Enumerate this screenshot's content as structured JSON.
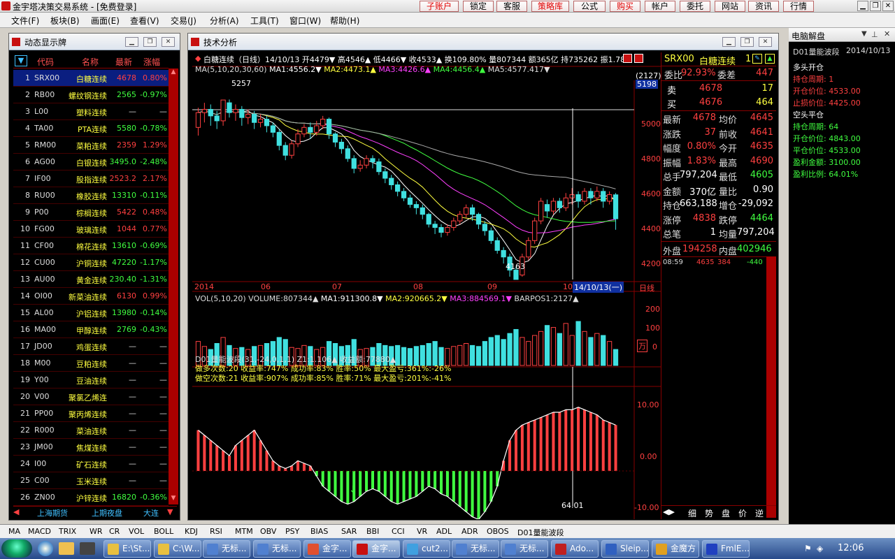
{
  "app": {
    "title": "金宇塔决策交易系统 - [免费登录]"
  },
  "topbuttons": [
    {
      "label": "子账户",
      "red": true
    },
    {
      "label": "锁定",
      "red": false
    },
    {
      "label": "客服",
      "red": false
    },
    {
      "label": "策略库",
      "red": true
    },
    {
      "label": "公式",
      "red": false
    },
    {
      "label": "购买",
      "red": true
    },
    {
      "label": "帐户",
      "red": false
    },
    {
      "label": "委托",
      "red": false
    },
    {
      "label": "网站",
      "red": false
    },
    {
      "label": "资讯",
      "red": false
    },
    {
      "label": "行情",
      "red": false
    }
  ],
  "menu": [
    "文件(F)",
    "板块(B)",
    "画面(E)",
    "查看(V)",
    "交易(J)",
    "分析(A)",
    "工具(T)",
    "窗口(W)",
    "帮助(H)"
  ],
  "leftpanel": {
    "title": "动态显示牌",
    "headers": {
      "code": "代码",
      "name": "名称",
      "last": "最新",
      "chg": "涨幅"
    },
    "rows": [
      {
        "n": "1",
        "code": "SRX00",
        "name": "白糖连续",
        "last": "4678",
        "chg": "0.80%",
        "up": true
      },
      {
        "n": "2",
        "code": "RB00",
        "name": "螺纹钢连续",
        "last": "2565",
        "chg": "-0.97%",
        "up": false
      },
      {
        "n": "3",
        "code": "L00",
        "name": "塑料连续",
        "last": "—",
        "chg": "—",
        "up": null
      },
      {
        "n": "4",
        "code": "TA00",
        "name": "PTA连续",
        "last": "5580",
        "chg": "-0.78%",
        "up": false
      },
      {
        "n": "5",
        "code": "RM00",
        "name": "菜粕连续",
        "last": "2359",
        "chg": "1.29%",
        "up": true
      },
      {
        "n": "6",
        "code": "AG00",
        "name": "白银连续",
        "last": "3495.0",
        "chg": "-2.48%",
        "up": false
      },
      {
        "n": "7",
        "code": "IF00",
        "name": "股指连续",
        "last": "2523.2",
        "chg": "2.17%",
        "up": true
      },
      {
        "n": "8",
        "code": "RU00",
        "name": "橡胶连续",
        "last": "13310",
        "chg": "-0.11%",
        "up": false
      },
      {
        "n": "9",
        "code": "P00",
        "name": "棕榈连续",
        "last": "5422",
        "chg": "0.48%",
        "up": true
      },
      {
        "n": "10",
        "code": "FG00",
        "name": "玻璃连续",
        "last": "1044",
        "chg": "0.77%",
        "up": true
      },
      {
        "n": "11",
        "code": "CF00",
        "name": "棉花连续",
        "last": "13610",
        "chg": "-0.69%",
        "up": false
      },
      {
        "n": "12",
        "code": "CU00",
        "name": "沪铜连续",
        "last": "47220",
        "chg": "-1.17%",
        "up": false
      },
      {
        "n": "13",
        "code": "AU00",
        "name": "黄金连续",
        "last": "230.40",
        "chg": "-1.31%",
        "up": false
      },
      {
        "n": "14",
        "code": "OI00",
        "name": "新菜油连续",
        "last": "6130",
        "chg": "0.99%",
        "up": true
      },
      {
        "n": "15",
        "code": "AL00",
        "name": "沪铝连续",
        "last": "13980",
        "chg": "-0.14%",
        "up": false
      },
      {
        "n": "16",
        "code": "MA00",
        "name": "甲醇连续",
        "last": "2769",
        "chg": "-0.43%",
        "up": false
      },
      {
        "n": "17",
        "code": "JD00",
        "name": "鸡蛋连续",
        "last": "—",
        "chg": "—",
        "up": null
      },
      {
        "n": "18",
        "code": "M00",
        "name": "豆粕连续",
        "last": "—",
        "chg": "—",
        "up": null
      },
      {
        "n": "19",
        "code": "Y00",
        "name": "豆油连续",
        "last": "—",
        "chg": "—",
        "up": null
      },
      {
        "n": "20",
        "code": "V00",
        "name": "聚氯乙烯连",
        "last": "—",
        "chg": "—",
        "up": null
      },
      {
        "n": "21",
        "code": "PP00",
        "name": "聚丙烯连续",
        "last": "—",
        "chg": "—",
        "up": null
      },
      {
        "n": "22",
        "code": "R000",
        "name": "菜油连续",
        "last": "—",
        "chg": "—",
        "up": null
      },
      {
        "n": "23",
        "code": "JM00",
        "name": "焦煤连续",
        "last": "—",
        "chg": "—",
        "up": null
      },
      {
        "n": "24",
        "code": "I00",
        "name": "矿石连续",
        "last": "—",
        "chg": "—",
        "up": null
      },
      {
        "n": "25",
        "code": "C00",
        "name": "玉米连续",
        "last": "—",
        "chg": "—",
        "up": null
      },
      {
        "n": "26",
        "code": "ZN00",
        "name": "沪锌连续",
        "last": "16820",
        "chg": "-0.36%",
        "up": false
      }
    ],
    "tabs": [
      "上海期货",
      "上期夜盘",
      "大连"
    ]
  },
  "ta": {
    "title": "技术分析",
    "header": "白糖连续（日线）14/10/13 开4479▼ 高4546▲ 低4466▼ 收4533▲ 换109.80% 量807344 额365亿 持735262 振1.78%",
    "ma_line": {
      "prefix": "MA(5,10,20,30,60)",
      "ma1": "MA1:4556.2▼",
      "ma2": "MA2:4473.1▲",
      "ma3": "MA3:4426.6▲",
      "ma4": "MA4:4456.4▲",
      "ma5": "MA5:4577.417▼"
    },
    "vol_line": {
      "prefix": "VOL(5,10,20) VOLUME:807344▲",
      "ma1": "MA1:911300.8▼",
      "ma2": "MA2:920665.2▼",
      "ma3": "MA3:884569.1▼",
      "bar": "BARPOS1:2127▲"
    },
    "ind_line": "D01量能波段(31,-24,0,1,1) Z1:1.106▲ 收益额:77880▲",
    "stats1": "做多次数:20  收益率:747%  成功率:83%  胜率:50%  最大盈亏:361%:-26%",
    "stats2": "做空次数:21  收益率:907%  成功率:85%  胜率:71%  最大盈亏:201%:-41%",
    "price_axis": [
      "5000",
      "4800",
      "4600",
      "4400",
      "4200"
    ],
    "price_tag_top": "(2127)",
    "price_tag": "5198",
    "high_label": "5257",
    "low_label": "4163",
    "date_axis": [
      "2014",
      "06",
      "07",
      "08",
      "09",
      "10"
    ],
    "date_tag": "14/10/13(一)",
    "period": "日线",
    "vol_axis": [
      "200",
      "100",
      "0"
    ],
    "vol_unit": "万",
    "ind_axis": [
      "10.00",
      "0.00",
      "-10.00"
    ],
    "ind_value": "64.01"
  },
  "quote": {
    "symbol": "SRX00",
    "name": "白糖连续",
    "num": "1",
    "webi_label": "委比",
    "webi": "92.93%",
    "wecha_label": "委差",
    "wecha": "447",
    "sell_label": "卖",
    "sell": "4678",
    "sell_vol": "17",
    "buy_label": "买",
    "buy": "4676",
    "buy_vol": "464",
    "rows": [
      [
        "最新",
        "4678",
        "均价",
        "4645"
      ],
      [
        "涨跌",
        "37",
        "前收",
        "4641"
      ],
      [
        "幅度",
        "0.80%",
        "今开",
        "4635"
      ],
      [
        "振幅",
        "1.83%",
        "最高",
        "4690"
      ],
      [
        "总手",
        "797,204",
        "最低",
        "4605"
      ],
      [
        "金额",
        "370亿",
        "量比",
        "0.90"
      ],
      [
        "持仓",
        "663,188",
        "增仓",
        "-29,092"
      ],
      [
        "涨停",
        "4838",
        "跌停",
        "4464"
      ],
      [
        "总笔",
        "1",
        "均量",
        "797,204"
      ]
    ],
    "outer_label": "外盘",
    "outer": "194258",
    "inner_label": "内盘",
    "inner": "402946",
    "tick": {
      "time": "08:59",
      "price": "4635",
      "vol": "384",
      "chg": "-440"
    },
    "tabs": [
      "细",
      "势",
      "盘",
      "价",
      "逆"
    ]
  },
  "rightpanel": {
    "title": "电脑解盘",
    "sub": "D01量能波段",
    "date": "2014/10/13",
    "items": [
      {
        "t": "多头开仓",
        "c": "#ffffff"
      },
      {
        "t": "持仓周期: 1",
        "c": "#ff4040"
      },
      {
        "t": "开仓价位: 4533.00",
        "c": "#ff4040"
      },
      {
        "t": "止损价位: 4425.00",
        "c": "#ff4040"
      },
      {
        "t": "空头平仓",
        "c": "#ffffff"
      },
      {
        "t": "持仓周期: 64",
        "c": "#40ff40"
      },
      {
        "t": "开仓价位: 4843.00",
        "c": "#40ff40"
      },
      {
        "t": "平仓价位: 4533.00",
        "c": "#40ff40"
      },
      {
        "t": "盈利金额: 3100.00",
        "c": "#40ff40"
      },
      {
        "t": "盈利比例: 64.01%",
        "c": "#40ff40"
      }
    ]
  },
  "bottomtabs": [
    "MA",
    "MACD",
    "TRIX",
    "WR",
    "CR",
    "VOL",
    "BOLL",
    "KDJ",
    "RSI",
    "MTM",
    "OBV",
    "PSY",
    "BIAS",
    "SAR",
    "BBI",
    "CCI",
    "VR",
    "ADL",
    "ADR",
    "OBOS",
    "D01量能波段"
  ],
  "taskbar": {
    "items": [
      {
        "label": "E:\\St...",
        "color": "#e8c040"
      },
      {
        "label": "C:\\W...",
        "color": "#e8c040"
      },
      {
        "label": "无标...",
        "color": "#5080d0"
      },
      {
        "label": "无标...",
        "color": "#5080d0"
      },
      {
        "label": "金字...",
        "color": "#e05030"
      },
      {
        "label": "金字...",
        "color": "#c81010"
      },
      {
        "label": "cut2...",
        "color": "#40a0e0"
      },
      {
        "label": "无标...",
        "color": "#5080d0"
      },
      {
        "label": "无标...",
        "color": "#5080d0"
      },
      {
        "label": "Ado...",
        "color": "#c02020"
      },
      {
        "label": "Sleip...",
        "color": "#3060c0"
      },
      {
        "label": "金魔方",
        "color": "#e0a020"
      },
      {
        "label": "FmlE...",
        "color": "#2040c0"
      }
    ],
    "clock": "12:06"
  },
  "chart_data": {
    "type": "candlestick",
    "ylim": [
      4150,
      5300
    ],
    "candles": [
      [
        5090,
        5180,
        5040,
        5210
      ],
      [
        5180,
        5200,
        5120,
        5240
      ],
      [
        5200,
        5160,
        5100,
        5230
      ],
      [
        5160,
        5130,
        5080,
        5190
      ],
      [
        5130,
        5257,
        5100,
        5257
      ],
      [
        5240,
        5180,
        5150,
        5260
      ],
      [
        5180,
        5200,
        5130,
        5230
      ],
      [
        5200,
        5150,
        5100,
        5220
      ],
      [
        5150,
        5170,
        5110,
        5200
      ],
      [
        5170,
        5120,
        5080,
        5190
      ],
      [
        5120,
        5140,
        5090,
        5170
      ],
      [
        5140,
        5100,
        5060,
        5160
      ],
      [
        5100,
        5060,
        5030,
        5120
      ],
      [
        5060,
        4980,
        4950,
        5080
      ],
      [
        4980,
        4920,
        4890,
        5000
      ],
      [
        4920,
        4990,
        4900,
        5010
      ],
      [
        4990,
        5050,
        4970,
        5080
      ],
      [
        5050,
        5090,
        5030,
        5110
      ],
      [
        5090,
        5060,
        5020,
        5120
      ],
      [
        5060,
        5100,
        5040,
        5130
      ],
      [
        5100,
        5140,
        5080,
        5160
      ],
      [
        5140,
        5050,
        5020,
        5150
      ],
      [
        5050,
        5000,
        4970,
        5060
      ],
      [
        5000,
        4960,
        4930,
        5020
      ],
      [
        4960,
        4900,
        4880,
        4980
      ],
      [
        4900,
        4840,
        4810,
        4920
      ],
      [
        4840,
        4860,
        4820,
        4890
      ],
      [
        4860,
        4900,
        4840,
        4920
      ],
      [
        4900,
        4880,
        4840,
        4920
      ],
      [
        4880,
        4820,
        4800,
        4900
      ],
      [
        4820,
        4780,
        4750,
        4840
      ],
      [
        4780,
        4740,
        4710,
        4800
      ],
      [
        4740,
        4700,
        4670,
        4760
      ],
      [
        4700,
        4660,
        4640,
        4720
      ],
      [
        4660,
        4620,
        4600,
        4680
      ],
      [
        4620,
        4600,
        4560,
        4640
      ],
      [
        4600,
        4560,
        4530,
        4620
      ],
      [
        4560,
        4500,
        4480,
        4570
      ],
      [
        4500,
        4480,
        4440,
        4520
      ],
      [
        4480,
        4450,
        4420,
        4500
      ],
      [
        4450,
        4480,
        4430,
        4500
      ],
      [
        4480,
        4520,
        4460,
        4540
      ],
      [
        4520,
        4560,
        4500,
        4580
      ],
      [
        4560,
        4600,
        4540,
        4620
      ],
      [
        4600,
        4560,
        4520,
        4620
      ],
      [
        4560,
        4500,
        4470,
        4570
      ],
      [
        4500,
        4460,
        4430,
        4520
      ],
      [
        4460,
        4400,
        4380,
        4480
      ],
      [
        4400,
        4340,
        4320,
        4420
      ],
      [
        4340,
        4300,
        4260,
        4360
      ],
      [
        4300,
        4220,
        4180,
        4320
      ],
      [
        4220,
        4163,
        4163,
        4240
      ],
      [
        4190,
        4300,
        4180,
        4320
      ],
      [
        4300,
        4400,
        4280,
        4420
      ],
      [
        4400,
        4520,
        4380,
        4540
      ],
      [
        4520,
        4640,
        4500,
        4660
      ],
      [
        4620,
        4580,
        4540,
        4650
      ],
      [
        4580,
        4640,
        4560,
        4660
      ],
      [
        4640,
        4600,
        4570,
        4660
      ],
      [
        4600,
        4660,
        4580,
        4690
      ],
      [
        4660,
        4680,
        4620,
        4720
      ],
      [
        4680,
        4640,
        4600,
        4700
      ],
      [
        4640,
        4700,
        4620,
        4720
      ],
      [
        4700,
        4660,
        4620,
        4720
      ],
      [
        4660,
        4700,
        4640,
        4730
      ],
      [
        4700,
        4640,
        4600,
        4720
      ],
      [
        4640,
        4680,
        4620,
        4700
      ],
      [
        4679,
        4533,
        4466,
        4690
      ]
    ],
    "vol": [
      120,
      95,
      80,
      110,
      140,
      100,
      85,
      90,
      80,
      95,
      100,
      110,
      120,
      140,
      130,
      90,
      85,
      100,
      95,
      80,
      90,
      120,
      110,
      95,
      100,
      130,
      80,
      85,
      90,
      110,
      100,
      95,
      100,
      90,
      85,
      95,
      100,
      110,
      120,
      90,
      85,
      95,
      100,
      110,
      100,
      95,
      120,
      140,
      150,
      130,
      160,
      180,
      140,
      120,
      150,
      170,
      200,
      190,
      160,
      210,
      150,
      220,
      170,
      140,
      160,
      150,
      120,
      80
    ],
    "ind": [
      8,
      7,
      6,
      5,
      4,
      3,
      5,
      6,
      7,
      8,
      6,
      4,
      2,
      1,
      0.5,
      1,
      2,
      1.5,
      1,
      -1,
      -3,
      -4,
      -5,
      -6,
      -6.5,
      -6,
      -5,
      -4,
      -3.5,
      -4,
      -5,
      -6,
      -6.5,
      -6,
      -5.5,
      -5,
      -4,
      -3,
      -3.5,
      -4.5,
      -5,
      -6,
      -7,
      -8,
      -9,
      -9.5,
      -8,
      -6,
      -3,
      2,
      6,
      8,
      9,
      9.5,
      10,
      10.5,
      11,
      11.5,
      11.5,
      12,
      12,
      12.5,
      12,
      11.5,
      11,
      10,
      9.5,
      9
    ]
  }
}
